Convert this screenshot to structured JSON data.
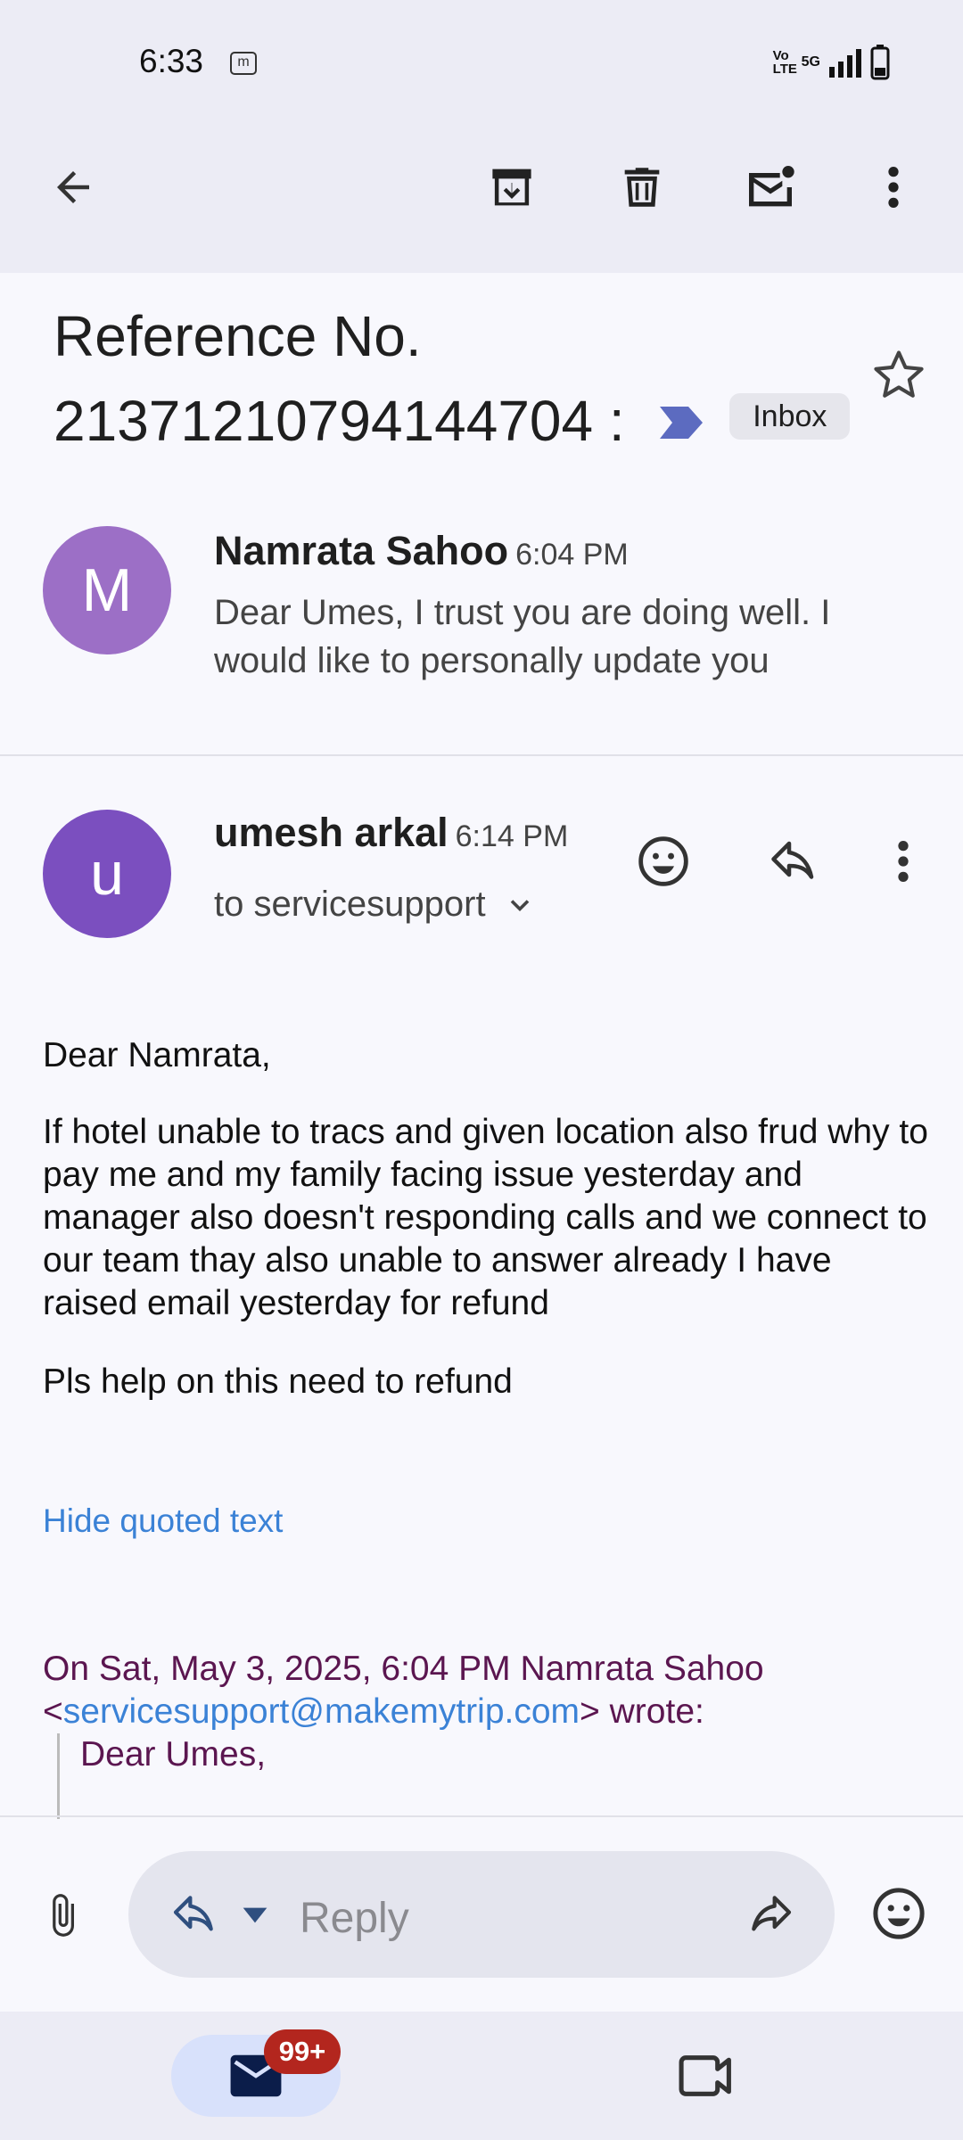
{
  "status_bar": {
    "time": "6:33",
    "notification_icon_letter": "m",
    "network_labels": [
      "Vo LTE",
      "5G"
    ]
  },
  "toolbar": {
    "icons": [
      "back-arrow-icon",
      "archive-icon",
      "delete-icon",
      "mark-unread-icon",
      "more-vert-icon"
    ]
  },
  "email": {
    "subject": "Reference No. 21371210794144704 :",
    "label": "Inbox",
    "colors": {
      "label_arrow": "#5c6bc0",
      "avatar_m": "#9c6fc6",
      "avatar_u": "#7b4fbf"
    }
  },
  "thread": [
    {
      "avatar_letter": "M",
      "sender": "Namrata Sahoo",
      "time": "6:04 PM",
      "snippet": "Dear Umes, I trust you are doing well. I would like to personally update you"
    },
    {
      "avatar_letter": "u",
      "sender": "umesh arkal",
      "time": "6:14 PM",
      "recipient": "to servicesupport"
    }
  ],
  "message": {
    "greeting": "Dear Namrata,",
    "paragraph1": "If hotel unable to tracs and given location also frud why to pay me and my family facing issue yesterday and manager also doesn't responding calls and we connect to our team thay also unable to answer already I have raised email yesterday for refund",
    "paragraph2": "Pls help on this need to refund",
    "hide_quoted": "Hide quoted text",
    "quote_header_1": "On Sat, May 3, 2025, 6:04 PM Namrata Sahoo",
    "quote_lt": "<",
    "quote_email": "servicesupport@makemytrip.com",
    "quote_header_2": "> wrote:",
    "quoted_line": "Dear Umes,"
  },
  "reply_bar": {
    "placeholder": "Reply"
  },
  "bottom_nav": {
    "mail_badge": "99+"
  }
}
